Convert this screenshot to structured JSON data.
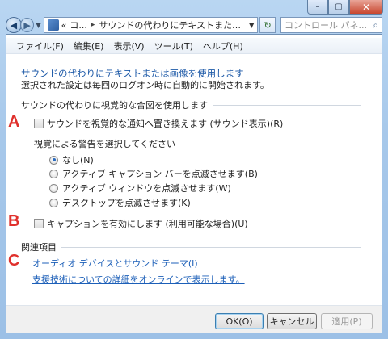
{
  "window": {
    "minimize_glyph": "–",
    "maximize_glyph": "▢",
    "close_glyph": "✕"
  },
  "nav": {
    "back_icon": "back-arrow",
    "forward_icon": "forward-arrow",
    "address_prefix": "«",
    "address_parent": "コ...",
    "address_separator": "▸",
    "address_current": "サウンドの代わりにテキストまたは画...",
    "search_placeholder": "コントロール パネ..."
  },
  "menubar": {
    "items": [
      "ファイル(F)",
      "編集(E)",
      "表示(V)",
      "ツール(T)",
      "ヘルプ(H)"
    ]
  },
  "page": {
    "title": "サウンドの代わりにテキストまたは画像を使用します",
    "subtitle": "選択された設定は毎回のログオン時に自動的に開始されます。",
    "section_header": "サウンドの代わりに視覚的な合図を使用します",
    "marker_a": "A",
    "marker_b": "B",
    "marker_c": "C",
    "sound_sentry_label": "サウンドを視覚的な通知へ置き換えます (サウンド表示)(R)",
    "visual_warning_label": "視覚による警告を選択してください",
    "radio_options": [
      "なし(N)",
      "アクティブ キャプション バーを点滅させます(B)",
      "アクティブ ウィンドウを点滅させます(W)",
      "デスクトップを点滅させます(K)"
    ],
    "selected_radio": 0,
    "captions_label": "キャプションを有効にします (利用可能な場合)(U)",
    "related_header": "関連項目",
    "related_link_1": "オーディオ デバイスとサウンド テーマ(I)",
    "related_link_2": "支援技術についての詳細をオンラインで表示します。"
  },
  "buttons": {
    "ok": "OK(O)",
    "cancel": "キャンセル",
    "apply": "適用(P)"
  },
  "colors": {
    "link": "#1c5fb8",
    "title": "#1e5aa8",
    "marker": "#e0302c"
  }
}
